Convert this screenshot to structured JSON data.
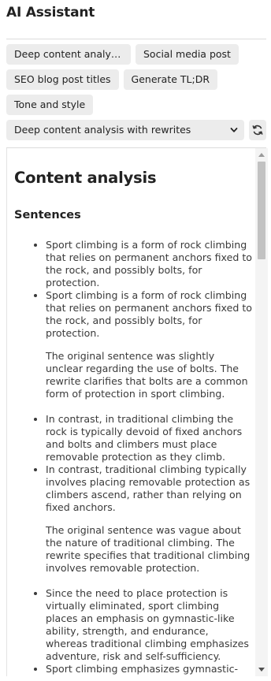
{
  "app": {
    "title": "AI Assistant"
  },
  "prompts": [
    "Deep content analysis with rewrites",
    "Social media post",
    "SEO blog post titles",
    "Generate TL;DR",
    "Tone and style"
  ],
  "selector": {
    "value": "Deep content analysis with rewrites",
    "icons": [
      "chevron-down-icon",
      "refresh-icon"
    ]
  },
  "output": {
    "heading": "Content analysis",
    "section": "Sentences",
    "groups": [
      {
        "original": "Sport climbing is a form of rock climbing that relies on permanent anchors fixed to the rock, and possibly bolts, for protection.",
        "rewrite": "Sport climbing is a form of rock climbing that relies on permanent anchors fixed to the rock, and possibly bolts, for protection.",
        "explanation": "The original sentence was slightly unclear regarding the use of bolts. The rewrite clarifies that bolts are a common form of protection in sport climbing."
      },
      {
        "original": "In contrast, in traditional climbing the rock is typically devoid of fixed anchors and bolts and climbers must place removable protection as they climb.",
        "rewrite": "In contrast, traditional climbing typically involves placing removable protection as climbers ascend, rather than relying on fixed anchors.",
        "explanation": "The original sentence was vague about the nature of traditional climbing. The rewrite specifies that traditional climbing involves removable protection."
      },
      {
        "original": "Since the need to place protection is virtually eliminated, sport climbing places an emphasis on gymnastic-like ability, strength, and endurance, whereas traditional climbing emphasizes adventure, risk and self-sufficiency.",
        "rewrite": "Sport climbing emphasizes gymnastic-like ability, strength, and endurance, while traditional climbing focuses on adventure, risk, and self-sufficiency."
      }
    ]
  }
}
